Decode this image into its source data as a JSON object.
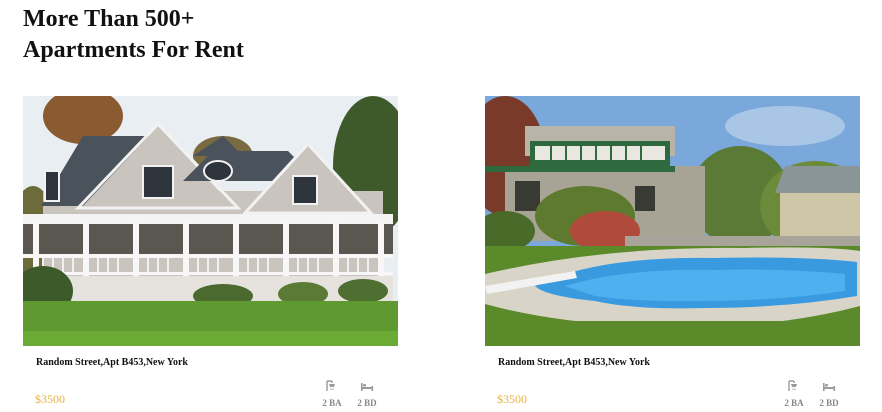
{
  "heading": {
    "line1": "More Than 500+",
    "line2": "Apartments For Rent"
  },
  "colors": {
    "price": "#e8b23a",
    "stat_text": "#888888",
    "stat_icon": "#9a9a9a"
  },
  "listings": [
    {
      "image": "white-porch-house-photo",
      "address": "Random Street,Apt B453,New York",
      "price": "$3500",
      "baths": {
        "icon": "bath-icon",
        "label": "2 BA"
      },
      "beds": {
        "icon": "bed-icon",
        "label": "2 BD"
      }
    },
    {
      "image": "house-with-pool-photo",
      "address": "Random Street,Apt B453,New York",
      "price": "$3500",
      "baths": {
        "icon": "bath-icon",
        "label": "2 BA"
      },
      "beds": {
        "icon": "bed-icon",
        "label": "2 BD"
      }
    }
  ]
}
